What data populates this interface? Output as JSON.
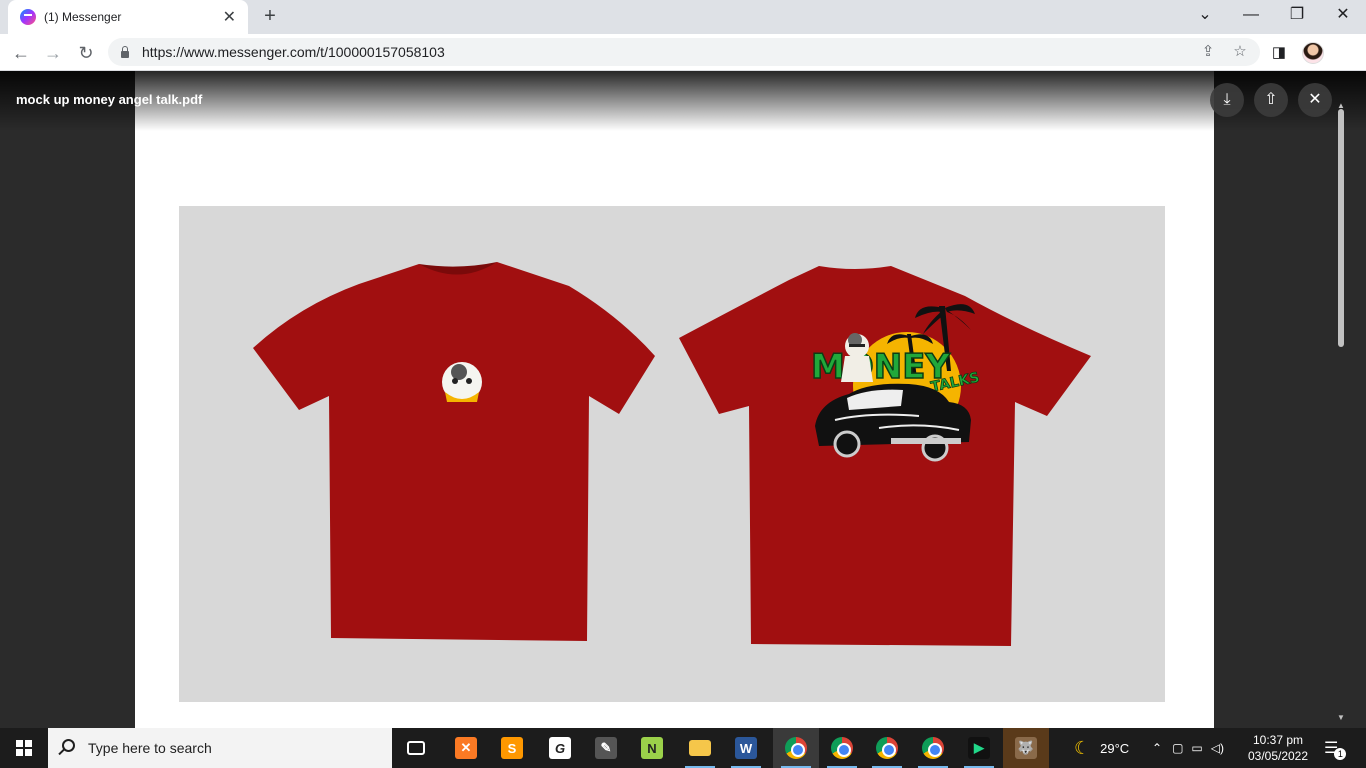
{
  "browser": {
    "tab_title": "(1) Messenger",
    "tab_close": "✕",
    "new_tab": "+",
    "window_controls": {
      "dropdown": "⌄",
      "minimize": "—",
      "restore": "❐",
      "close": "✕"
    },
    "nav": {
      "back": "←",
      "forward": "→",
      "reload": "↻"
    },
    "url": "https://www.messenger.com/t/100000157058103",
    "icons": {
      "share": "⇪",
      "bookmark": "☆",
      "sidebar": "◨"
    }
  },
  "viewer": {
    "file_name": "mock up money angel talk.pdf",
    "download_icon": "⤓",
    "share_icon": "⇧",
    "close_icon": "✕",
    "mockup_colors": {
      "shirt": "#a10f10",
      "background": "#d8d8d8",
      "logo_green": "#21a83a",
      "logo_sun": "#f5b400"
    },
    "logo_text_main": "MONEY",
    "logo_text_sub": "TALKS"
  },
  "taskbar": {
    "search_placeholder": "Type here to search",
    "weather": "29°C",
    "time": "10:37 pm",
    "date": "03/05/2022",
    "notification_count": "1",
    "apps": [
      "task-view",
      "xampp",
      "sublime-text",
      "g-app",
      "gimp-like",
      "notepad-plus",
      "file-explorer",
      "word",
      "chrome",
      "chrome",
      "chrome",
      "chrome",
      "pycharm",
      "gimp"
    ]
  }
}
